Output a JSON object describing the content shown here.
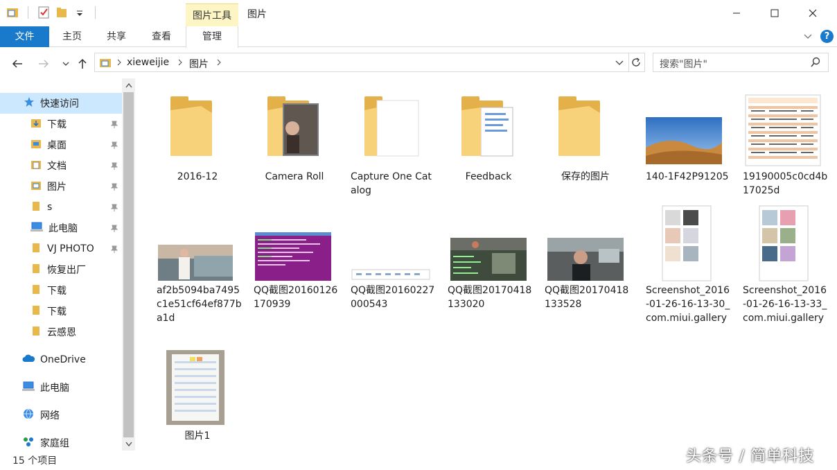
{
  "window": {
    "context_tab_group": "图片工具",
    "title": "图片"
  },
  "ribbon": {
    "tabs": [
      {
        "label": "文件"
      },
      {
        "label": "主页"
      },
      {
        "label": "共享"
      },
      {
        "label": "查看"
      },
      {
        "label": "管理"
      }
    ],
    "accent_color": "#1979ca",
    "context_color": "#fdf5c3"
  },
  "address_bar": {
    "crumbs": [
      "xieweijie",
      "图片"
    ],
    "search_placeholder": "搜索\"图片\""
  },
  "sidebar": {
    "quick_access": "快速访问",
    "items": [
      {
        "label": "下载",
        "icon": "download-folder-icon",
        "pinned": true
      },
      {
        "label": "桌面",
        "icon": "desktop-folder-icon",
        "pinned": true
      },
      {
        "label": "文档",
        "icon": "documents-folder-icon",
        "pinned": true
      },
      {
        "label": "图片",
        "icon": "pictures-folder-icon",
        "pinned": true
      },
      {
        "label": "s",
        "icon": "folder-icon",
        "pinned": true
      },
      {
        "label": "此电脑",
        "icon": "computer-icon",
        "pinned": true
      },
      {
        "label": "VJ PHOTO",
        "icon": "folder-icon",
        "pinned": true
      },
      {
        "label": "恢复出厂",
        "icon": "folder-icon",
        "pinned": false
      },
      {
        "label": "下载",
        "icon": "folder-icon",
        "pinned": false
      },
      {
        "label": "下载",
        "icon": "folder-icon",
        "pinned": false
      },
      {
        "label": "云感恩",
        "icon": "folder-icon",
        "pinned": false
      }
    ],
    "onedrive": "OneDrive",
    "this_pc": "此电脑",
    "network": "网络",
    "homegroup": "家庭组"
  },
  "files": [
    {
      "name": "2016-12",
      "kind": "folder"
    },
    {
      "name": "Camera Roll",
      "kind": "folder-photo"
    },
    {
      "name": "Capture One Catalog",
      "kind": "folder-doc"
    },
    {
      "name": "Feedback",
      "kind": "folder-docs"
    },
    {
      "name": "保存的图片",
      "kind": "folder"
    },
    {
      "name": "140-1F42P91205",
      "kind": "desert"
    },
    {
      "name": "19190005c0cd4b17025d",
      "kind": "table"
    },
    {
      "name": "af2b5094ba7495c1e51cf64ef877ba1d",
      "kind": "car-photo"
    },
    {
      "name": "QQ截图20160126170939",
      "kind": "terminal"
    },
    {
      "name": "QQ截图20160227000543",
      "kind": "strip"
    },
    {
      "name": "QQ截图20170418133020",
      "kind": "video"
    },
    {
      "name": "QQ截图20170418133528",
      "kind": "video2"
    },
    {
      "name": "Screenshot_2016-01-26-16-13-30_com.miui.gallery",
      "kind": "phone"
    },
    {
      "name": "Screenshot_2016-01-26-16-13-33_com.miui.gallery",
      "kind": "phone2"
    },
    {
      "name": "图片1",
      "kind": "sheet"
    }
  ],
  "status": {
    "item_count": "15 个项目"
  },
  "watermark": "头条号 / 简单科技"
}
